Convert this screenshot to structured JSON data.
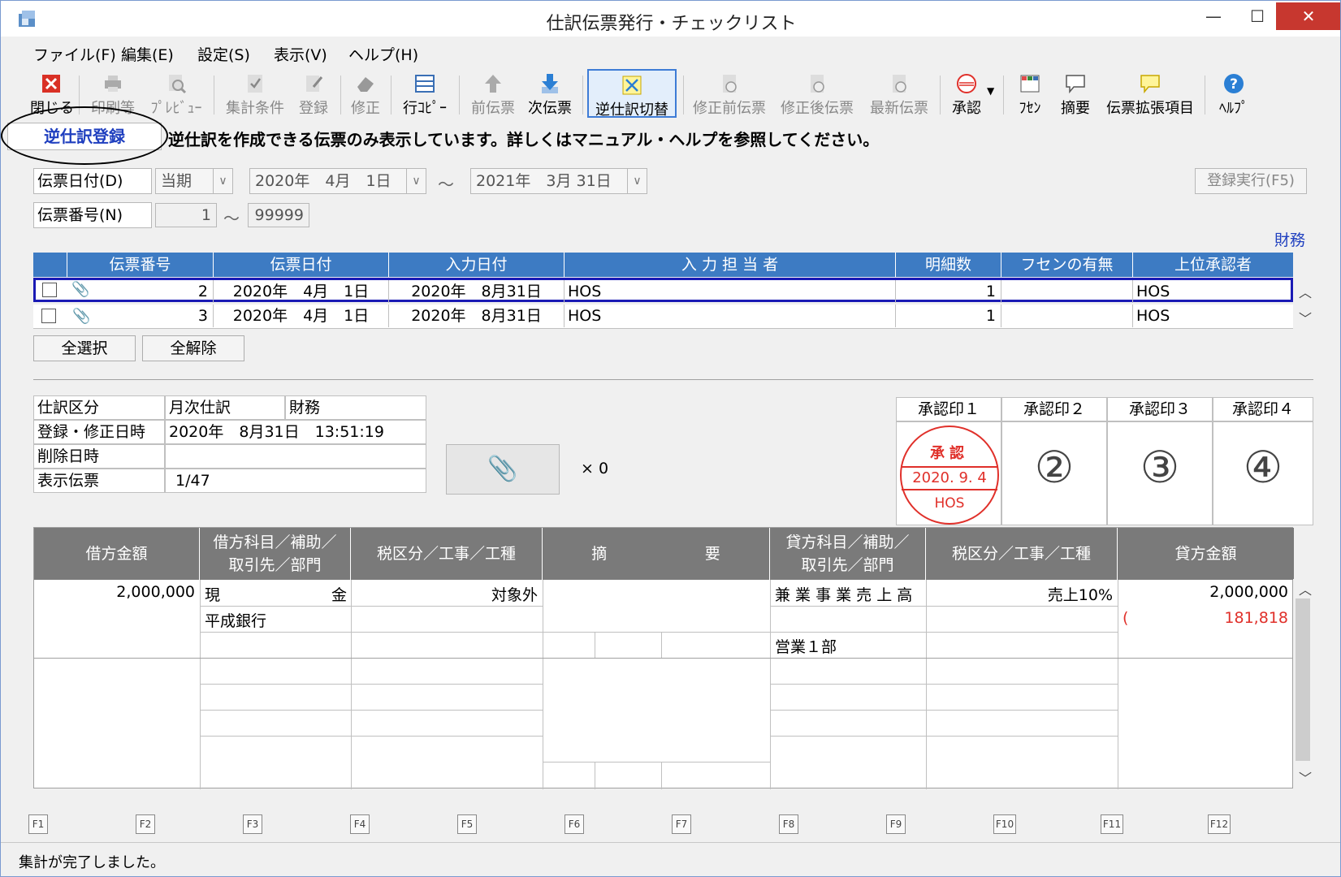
{
  "window": {
    "title": "仕訳伝票発行・チェックリスト"
  },
  "menu": [
    "ファイル(F)",
    "編集(E)",
    "設定(S)",
    "表示(V)",
    "ヘルプ(H)"
  ],
  "toolbar": {
    "close": "閉じる",
    "print": "印刷等",
    "preview": "ﾌﾟﾚﾋﾞｭｰ",
    "aggregate": "集計条件",
    "register": "登録",
    "modify": "修正",
    "row_copy": "行ｺﾋﾟｰ",
    "prev": "前伝票",
    "next": "次伝票",
    "reverse_toggle": "逆仕訳切替",
    "before_edit": "修正前伝票",
    "after_edit": "修正後伝票",
    "latest": "最新伝票",
    "approve": "承認",
    "fusen": "ﾌｾﾝ",
    "summary": "摘要",
    "extend": "伝票拡張項目",
    "help": "ﾍﾙﾌﾟ"
  },
  "info": {
    "mode": "逆仕訳登録",
    "message": "逆仕訳を作成できる伝票のみ表示しています。詳しくはマニュアル・ヘルプを参照してください。"
  },
  "filter": {
    "date_label": "伝票日付(D)",
    "period": "当期",
    "date_from": "2020年　4月　1日",
    "tilde": "～",
    "date_to": "2021年　3月 31日",
    "number_label": "伝票番号(N)",
    "num_from": "1",
    "num_to": "99999",
    "exec_button": "登録実行(F5)",
    "dept": "財務"
  },
  "voucher_table": {
    "headers": [
      "伝票番号",
      "伝票日付",
      "入力日付",
      "入 力 担 当 者",
      "明細数",
      "フセンの有無",
      "上位承認者"
    ],
    "rows": [
      {
        "number": "2",
        "date": "2020年　4月　1日",
        "input_date": "2020年　8月31日",
        "person": "HOS",
        "count": "1",
        "fusen": "",
        "approver": "HOS"
      },
      {
        "number": "3",
        "date": "2020年　4月　1日",
        "input_date": "2020年　8月31日",
        "person": "HOS",
        "count": "1",
        "fusen": "",
        "approver": "HOS"
      }
    ]
  },
  "buttons": {
    "select_all": "全選択",
    "deselect_all": "全解除"
  },
  "detail": {
    "kind_label": "仕訳区分",
    "kind_value": "月次仕訳",
    "kind_dept": "財務",
    "updated_label": "登録・修正日時",
    "updated_value": "2020年　8月31日　13:51:19",
    "deleted_label": "削除日時",
    "deleted_value": "",
    "display_label": "表示伝票",
    "display_value": "1/47",
    "attach_count": "× 0"
  },
  "approvals": {
    "headers": [
      "承認印１",
      "承認印２",
      "承認印３",
      "承認印４"
    ],
    "stamp": {
      "top": "承認",
      "date": "2020. 9. 4",
      "name": "HOS"
    },
    "nums": [
      "②",
      "③",
      "④"
    ]
  },
  "journal": {
    "headers": {
      "debit_amount": "借方金額",
      "debit_acct_1": "借方科目／補助／",
      "debit_acct_2": "取引先／部門",
      "tax1": "税区分／工事／工種",
      "memo_a": "摘",
      "memo_b": "要",
      "credit_acct_1": "貸方科目／補助／",
      "credit_acct_2": "取引先／部門",
      "tax2": "税区分／工事／工種",
      "credit_amount": "貸方金額"
    },
    "row1": {
      "debit_amount": "2,000,000",
      "debit_acct_a": "現",
      "debit_acct_b": "金",
      "debit_sub": "平成銀行",
      "tax1": "対象外",
      "credit_acct": "兼 業 事 業 売 上 高",
      "credit_dept": "営業１部",
      "tax2": "売上10%",
      "credit_amount": "2,000,000",
      "credit_tax_paren": "(",
      "credit_tax": "181,818"
    }
  },
  "fkeys": [
    "F1",
    "F2",
    "F3",
    "F4",
    "F5",
    "F6",
    "F7",
    "F8",
    "F9",
    "F10",
    "F11",
    "F12"
  ],
  "status": "集計が完了しました。",
  "colors": {
    "header_blue": "#3d7bc3",
    "grid_header_gray": "#7a7a7a",
    "stamp_red": "#e0302a",
    "select_border": "#1a1ab4"
  }
}
